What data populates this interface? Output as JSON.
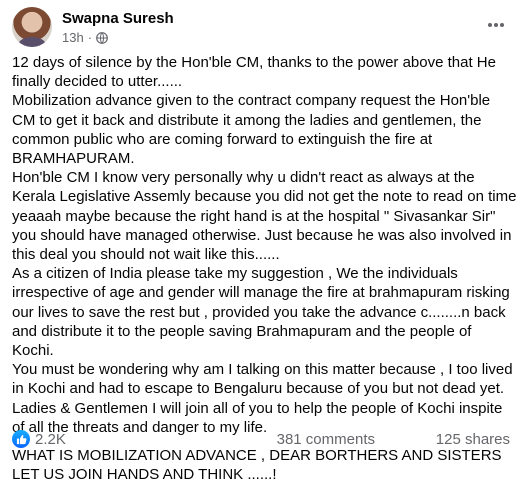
{
  "post": {
    "author": "Swapna Suresh",
    "time": "13h",
    "dot": "·",
    "paragraphs": [
      "12 days of silence by the Hon'ble CM, thanks to the power above that He finally decided to utter......",
      "Mobilization advance given to the contract company request the Hon'ble CM to get it back and distribute it among the ladies and gentlemen, the common public who are coming forward to extinguish the fire at BRAMHAPURAM.",
      "Hon'ble CM  I know very personally why u didn't react as always at the Kerala Legislative Assemly because you did not get the note to read on time yeaaah maybe because the right hand is at the hospital \" Sivasankar Sir\" you should have managed otherwise. Just because he was also involved in this deal you should not wait like this......",
      "As a citizen of India please take my suggestion , We the individuals irrespective of age and gender will manage the fire at brahmapuram risking our lives to save the rest but , provided you take the advance c........n back and distribute it to the people saving Brahmapuram and the people of Kochi.",
      "You must be wondering why am I talking on this matter because , I too lived in Kochi and had to escape to Bengaluru because of you but not dead yet.",
      "Ladies & Gentlemen  I will join all of you to help the people of Kochi inspite of all the threats and danger to my life.",
      "WHAT IS MOBILIZATION ADVANCE , DEAR BORTHERS AND SISTERS LET US JOIN HANDS AND THINK ......!"
    ]
  },
  "footer": {
    "likes": "2.2K",
    "comments": "381 comments",
    "shares": "125 shares"
  },
  "colors": {
    "text": "#050505",
    "secondary": "#65676b",
    "like_blue": "#0866ff"
  },
  "icons": {
    "privacy": "globe-icon",
    "menu": "more-options-icon",
    "reaction": "thumbs-up-icon"
  }
}
